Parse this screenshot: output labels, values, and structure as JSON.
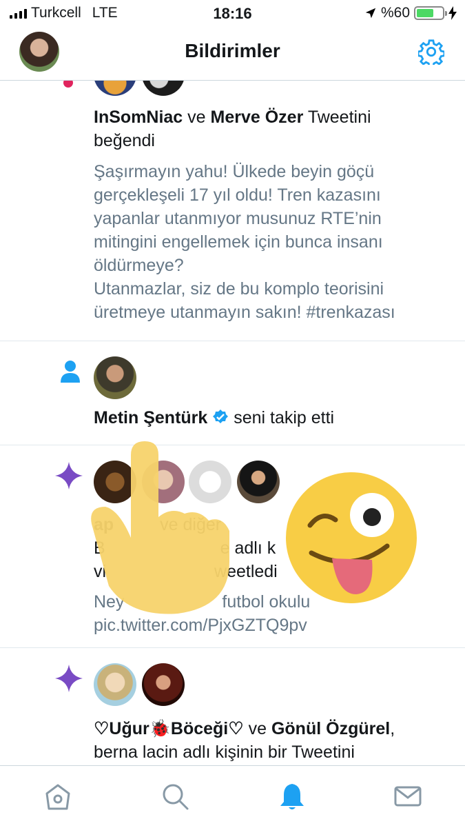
{
  "status": {
    "carrier": "Turkcell",
    "network": "LTE",
    "time": "18:16",
    "battery": "%60",
    "battery_level": 0.6
  },
  "header": {
    "title": "Bildirimler"
  },
  "notifications": [
    {
      "actor1": "InSomNiac",
      "conj": "ve",
      "actor2": "Merve Özer",
      "action": "Tweetini",
      "action2": "beğendi",
      "tweet_lines": [
        "Şaşırmayın yahu! Ülkede beyin göçü",
        "gerçekleşeli 17 yıl oldu! Tren kazasını",
        "yapanlar utanmıyor musunuz RTE’nin",
        "mitingini engellemek için bunca insanı",
        "öldürmeye?",
        "Utanmazlar, siz de bu komplo teorisini",
        "üretmeye utanmayın sakın! #trenkazası"
      ]
    },
    {
      "actor": "Metin Şentürk",
      "action": "seni takip etti"
    },
    {
      "line1_a": "ap",
      "line1_b": "ve diğer",
      "line2_a": "B",
      "line2_b": "e adlı k",
      "line3_a": "vi",
      "line3_b": "weetledi",
      "tweet_line1_a": "Ney",
      "tweet_line1_b": "futbol okulu",
      "tweet_line2": "pic.twitter.com/PjxGZTQ9pv"
    },
    {
      "actor1": "♡Uğur",
      "actor1_emoji": "🐞",
      "actor1_rest": "Böceği♡",
      "conj": "ve",
      "actor2": "Gönül Özgürel",
      "line2": "berna lacin adlı kişinin bir Tweetini"
    }
  ],
  "colors": {
    "accent": "#1da1f2",
    "purple": "#794bc4",
    "text_gray": "#657786"
  },
  "icons": [
    "home-icon",
    "search-icon",
    "bell-icon",
    "mail-icon",
    "gear-icon",
    "verified-icon",
    "sparkle-icon",
    "person-icon"
  ]
}
